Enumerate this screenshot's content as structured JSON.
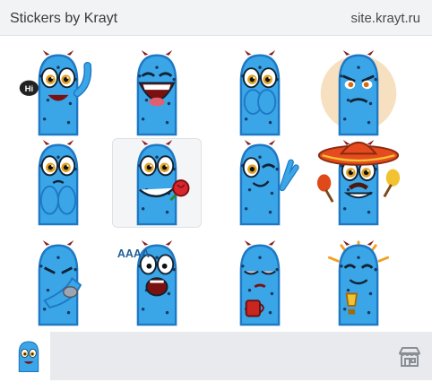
{
  "header": {
    "title": "Stickers by Krayt",
    "site": "site.krayt.ru"
  },
  "colors": {
    "header_bg": "#f2f3f5",
    "cactus_body": "#3aa6e8",
    "cactus_shade": "#1f78c4",
    "composer_bg": "#e8eaed",
    "selected_bg": "#f4f5f7"
  },
  "stickers": [
    {
      "name": "hi-wave",
      "badge": "Hi"
    },
    {
      "name": "laughing"
    },
    {
      "name": "shy-hands"
    },
    {
      "name": "angry-glow"
    },
    {
      "name": "sad-hug"
    },
    {
      "name": "rose-love",
      "selected": true
    },
    {
      "name": "wink-peace"
    },
    {
      "name": "sombrero-maracas"
    },
    {
      "name": "facepalm"
    },
    {
      "name": "screaming",
      "text": "AAAA"
    },
    {
      "name": "sleepy-coffee"
    },
    {
      "name": "victory-cup"
    }
  ],
  "footer": {
    "store_icon": "store-icon",
    "picker_icon": "sticker-thumbnail"
  }
}
